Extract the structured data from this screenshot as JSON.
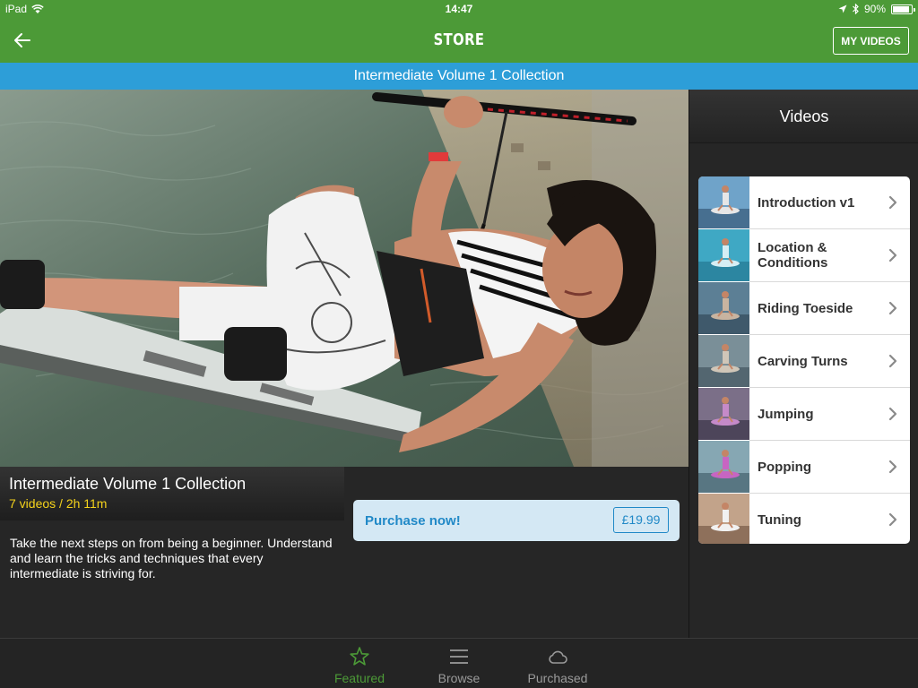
{
  "status_bar": {
    "device": "iPad",
    "time": "14:47",
    "battery": "90%",
    "battery_level": 0.9
  },
  "nav": {
    "title": "STORE",
    "my_videos_label": "MY VIDEOS"
  },
  "collection": {
    "banner_title": "Intermediate Volume 1 Collection",
    "title": "Intermediate Volume 1 Collection",
    "subtitle": "7 videos / 2h 11m",
    "description": "Take the next steps on from being a beginner. Understand and learn the tricks and techniques that every intermediate is striving for.",
    "purchase_label": "Purchase now!",
    "price": "£19.99"
  },
  "videos": {
    "header": "Videos",
    "items": [
      {
        "label": "Introduction v1"
      },
      {
        "label": "Location & Conditions"
      },
      {
        "label": "Riding Toeside"
      },
      {
        "label": "Carving Turns"
      },
      {
        "label": "Jumping"
      },
      {
        "label": "Popping"
      },
      {
        "label": "Tuning"
      }
    ]
  },
  "tabs": [
    {
      "label": "Featured",
      "active": true,
      "icon": "star-icon"
    },
    {
      "label": "Browse",
      "active": false,
      "icon": "list-icon"
    },
    {
      "label": "Purchased",
      "active": false,
      "icon": "cloud-icon"
    }
  ],
  "colors": {
    "brand_green": "#4c9a37",
    "banner_blue": "#2d9ed8",
    "subtitle_yellow": "#f4d21b",
    "purchase_blue": "#2189c7",
    "tab_active": "#4c9a37",
    "tab_inactive": "#9a9a9a"
  }
}
